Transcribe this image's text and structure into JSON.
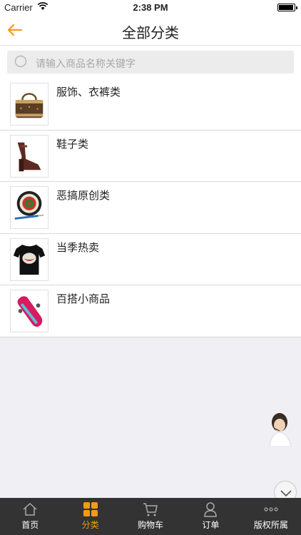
{
  "status_bar": {
    "carrier": "Carrier",
    "time": "2:38 PM"
  },
  "nav": {
    "title": "全部分类",
    "back_icon": "arrow-left-icon"
  },
  "search": {
    "placeholder": "请输入商品名称关键字",
    "icon": "search-icon"
  },
  "categories": [
    {
      "label": "服饰、衣裤类",
      "icon": "handbag-image"
    },
    {
      "label": "鞋子类",
      "icon": "high-heel-shoe-image"
    },
    {
      "label": "恶搞原创类",
      "icon": "dartboard-image"
    },
    {
      "label": "当季热卖",
      "icon": "tshirt-image"
    },
    {
      "label": "百搭小商品",
      "icon": "skateboard-image"
    }
  ],
  "tab_bar": {
    "tabs": [
      {
        "label": "首页",
        "icon": "home-icon",
        "active": false
      },
      {
        "label": "分类",
        "icon": "grid-icon",
        "active": true
      },
      {
        "label": "购物车",
        "icon": "cart-icon",
        "active": false
      },
      {
        "label": "订单",
        "icon": "person-icon",
        "active": false
      },
      {
        "label": "版权所属",
        "icon": "more-icon",
        "active": false
      }
    ]
  },
  "colors": {
    "accent": "#f39c11",
    "tab_bar_bg": "#333333",
    "page_bg": "#efeff4"
  }
}
